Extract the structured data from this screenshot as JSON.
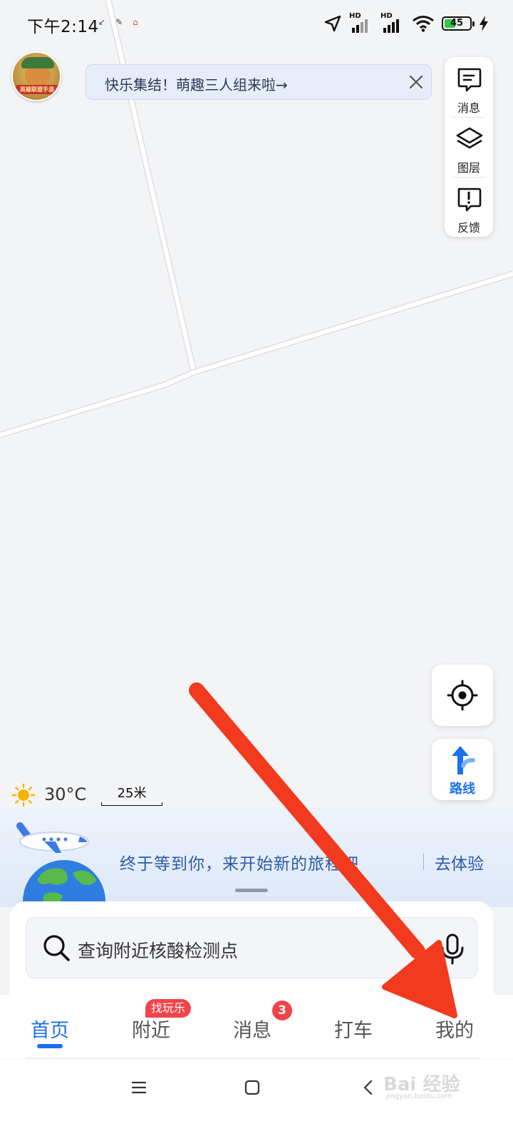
{
  "status_bar": {
    "time": "下午2:14",
    "notification_icons": [
      "message-icon",
      "signal-icon",
      "app-icon"
    ],
    "signal_labels": [
      "HD",
      "HD"
    ],
    "battery": "45",
    "battery_level": 0.45
  },
  "top": {
    "banner_text": "快乐集结！萌趣三人组来啦→",
    "game_avatar_label": "英雄联盟手游"
  },
  "side_panel": {
    "items": [
      {
        "label": "消息",
        "icon": "message-square-icon"
      },
      {
        "label": "图层",
        "icon": "layers-icon"
      },
      {
        "label": "反馈",
        "icon": "feedback-icon"
      }
    ]
  },
  "map_controls": {
    "route_label": "路线"
  },
  "weather": {
    "temperature": "30°C",
    "icon": "sun-icon"
  },
  "scale": {
    "label": "25米"
  },
  "promo": {
    "text": "终于等到你，来开始新的旅程吧",
    "cta": "去体验"
  },
  "search": {
    "placeholder": "查询附近核酸检测点"
  },
  "bottom_nav": {
    "items": [
      {
        "label": "首页",
        "active": true
      },
      {
        "label": "附近",
        "active": false
      },
      {
        "label": "消息",
        "active": false
      },
      {
        "label": "打车",
        "active": false
      },
      {
        "label": "我的",
        "active": false
      }
    ],
    "nearby_tag": "找玩乐",
    "message_badge": "3"
  },
  "watermark": {
    "text": "Bai 经验",
    "url": "jingyan.baidu.com"
  },
  "colors": {
    "accent": "#1a6ff0",
    "badge": "#f2434a",
    "arrow": "#f23a1e",
    "map_bg": "#f3f4f6"
  }
}
